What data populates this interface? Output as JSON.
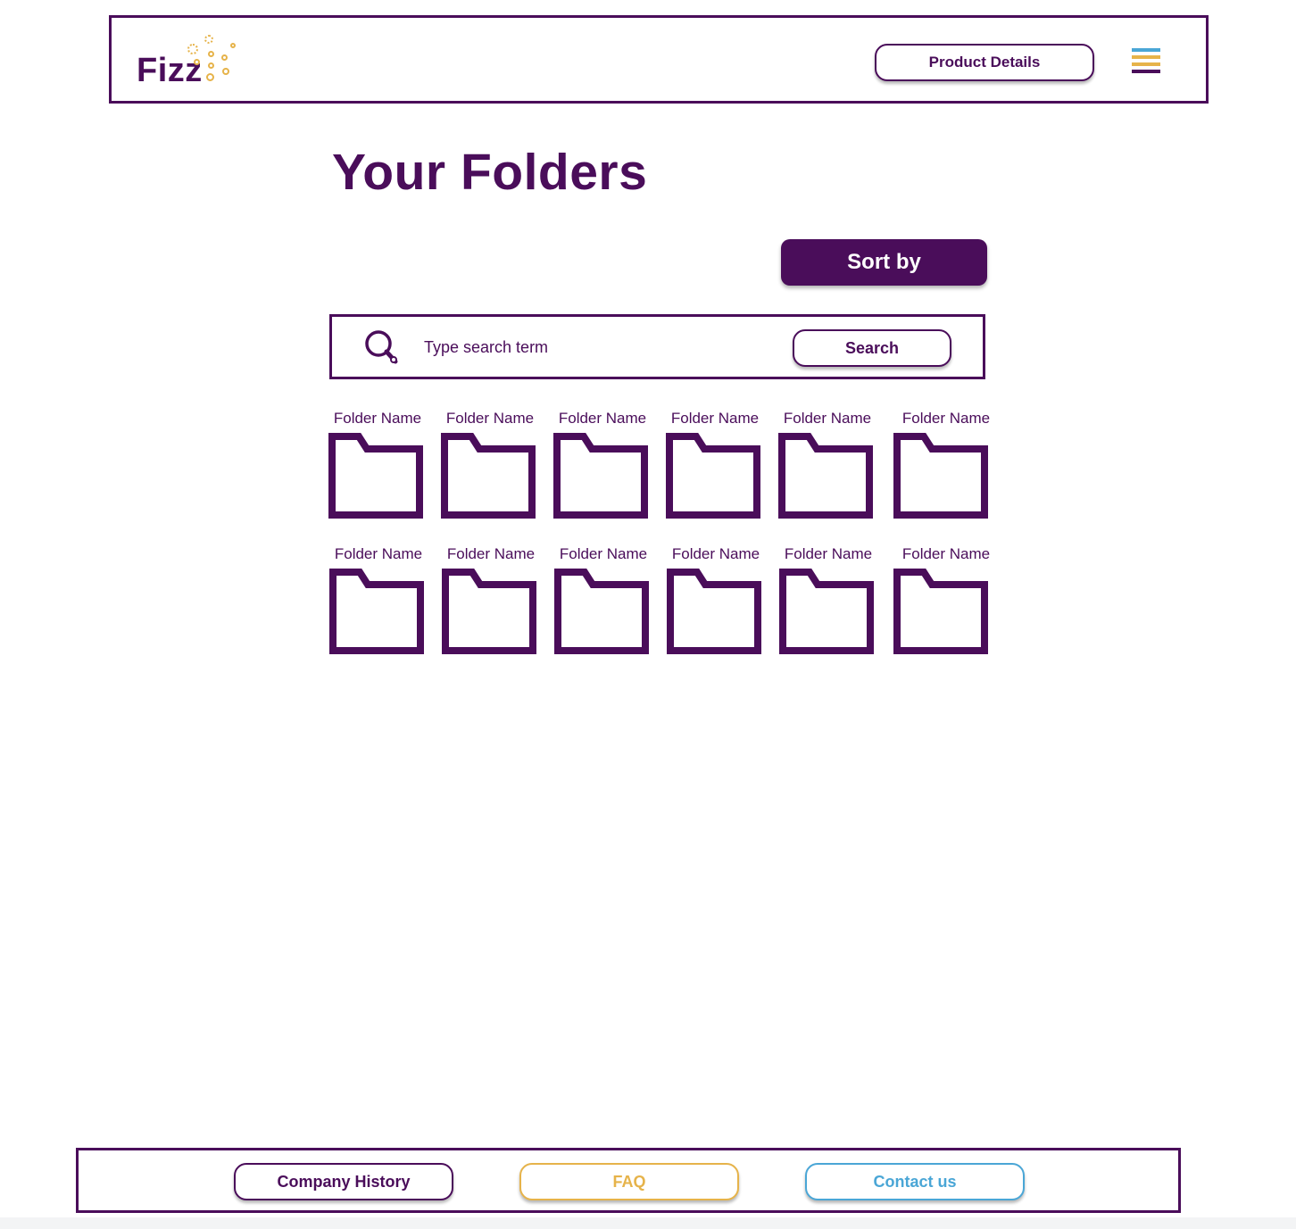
{
  "colors": {
    "primary": "#4a0d5a",
    "gold": "#e6b34a",
    "blue": "#4aa6d6"
  },
  "header": {
    "logo_text": "Fizz",
    "product_details_label": "Product Details",
    "menu_icon": "hamburger-menu-icon"
  },
  "main": {
    "title": "Your Folders",
    "sort_label": "Sort by",
    "search": {
      "icon": "search-icon",
      "placeholder": "Type search term",
      "button_label": "Search"
    },
    "folders": [
      {
        "label": "Folder Name"
      },
      {
        "label": "Folder Name"
      },
      {
        "label": "Folder Name"
      },
      {
        "label": "Folder Name"
      },
      {
        "label": "Folder Name"
      },
      {
        "label": "Folder Name"
      },
      {
        "label": "Folder Name"
      },
      {
        "label": "Folder Name"
      },
      {
        "label": "Folder Name"
      },
      {
        "label": "Folder Name"
      },
      {
        "label": "Folder Name"
      },
      {
        "label": "Folder Name"
      }
    ]
  },
  "footer": {
    "company_history_label": "Company History",
    "faq_label": "FAQ",
    "contact_label": "Contact us"
  }
}
